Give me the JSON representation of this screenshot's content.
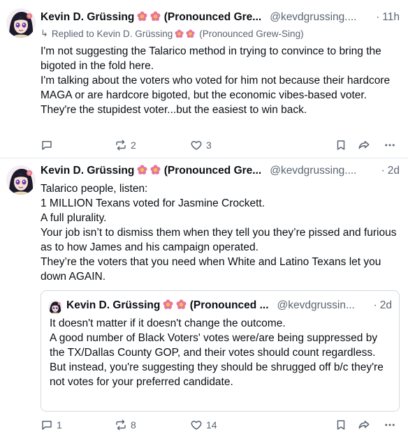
{
  "posts": [
    {
      "author": {
        "name": "Kevin D. Grüssing",
        "name_suffix": "(Pronounced Gre...",
        "handle": "@kevdgrussing....",
        "time": "11h"
      },
      "reply_to": {
        "label": "Replied to Kevin D. Grüssing",
        "suffix": "(Pronounced Grew-Sing)"
      },
      "paragraphs": [
        "I'm not suggesting the Talarico method in trying to convince to bring the bigoted in the fold here.",
        "I'm talking about the voters who voted for him not because their hardcore MAGA or are hardcore bigoted, but the economic vibes-based voter.",
        "They're the stupidest voter...but the easiest to win back."
      ],
      "actions": {
        "replies": "",
        "reposts": "2",
        "likes": "3"
      }
    },
    {
      "author": {
        "name": "Kevin D. Grüssing",
        "name_suffix": "(Pronounced Gre...",
        "handle": "@kevdgrussing....",
        "time": "2d"
      },
      "paragraphs": [
        "Talarico people, listen:",
        "1 MILLION Texans voted for Jasmine Crockett.",
        "A full plurality.",
        "Your job isn’t to dismiss them when they tell you they’re pissed and furious as to how James and his campaign operated.",
        "They’re the voters that you need when White and Latino Texans let you down AGAIN."
      ],
      "quote": {
        "author": {
          "name": "Kevin D. Grüssing",
          "name_suffix": "(Pronounced ...",
          "handle": "@kevdgrussin...",
          "time": "2d"
        },
        "paragraphs": [
          "It doesn't matter if it doesn't change the outcome.",
          "A good number of Black Voters' votes were/are being suppressed by the TX/Dallas County GOP, and their votes should count regardless.",
          "But instead, you're suggesting they should be shrugged off b/c they're not votes for your preferred candidate."
        ]
      },
      "actions": {
        "replies": "1",
        "reposts": "8",
        "likes": "14"
      }
    }
  ],
  "separator": "·",
  "colors": {
    "text": "#0b0f14",
    "muted": "#5b6572",
    "border": "#d4d9df",
    "emoji": "#d9609a"
  },
  "icons": [
    "reply-icon",
    "repost-icon",
    "like-icon",
    "bookmark-icon",
    "share-icon",
    "more-icon",
    "flower-emoji",
    "return-arrow-icon"
  ]
}
